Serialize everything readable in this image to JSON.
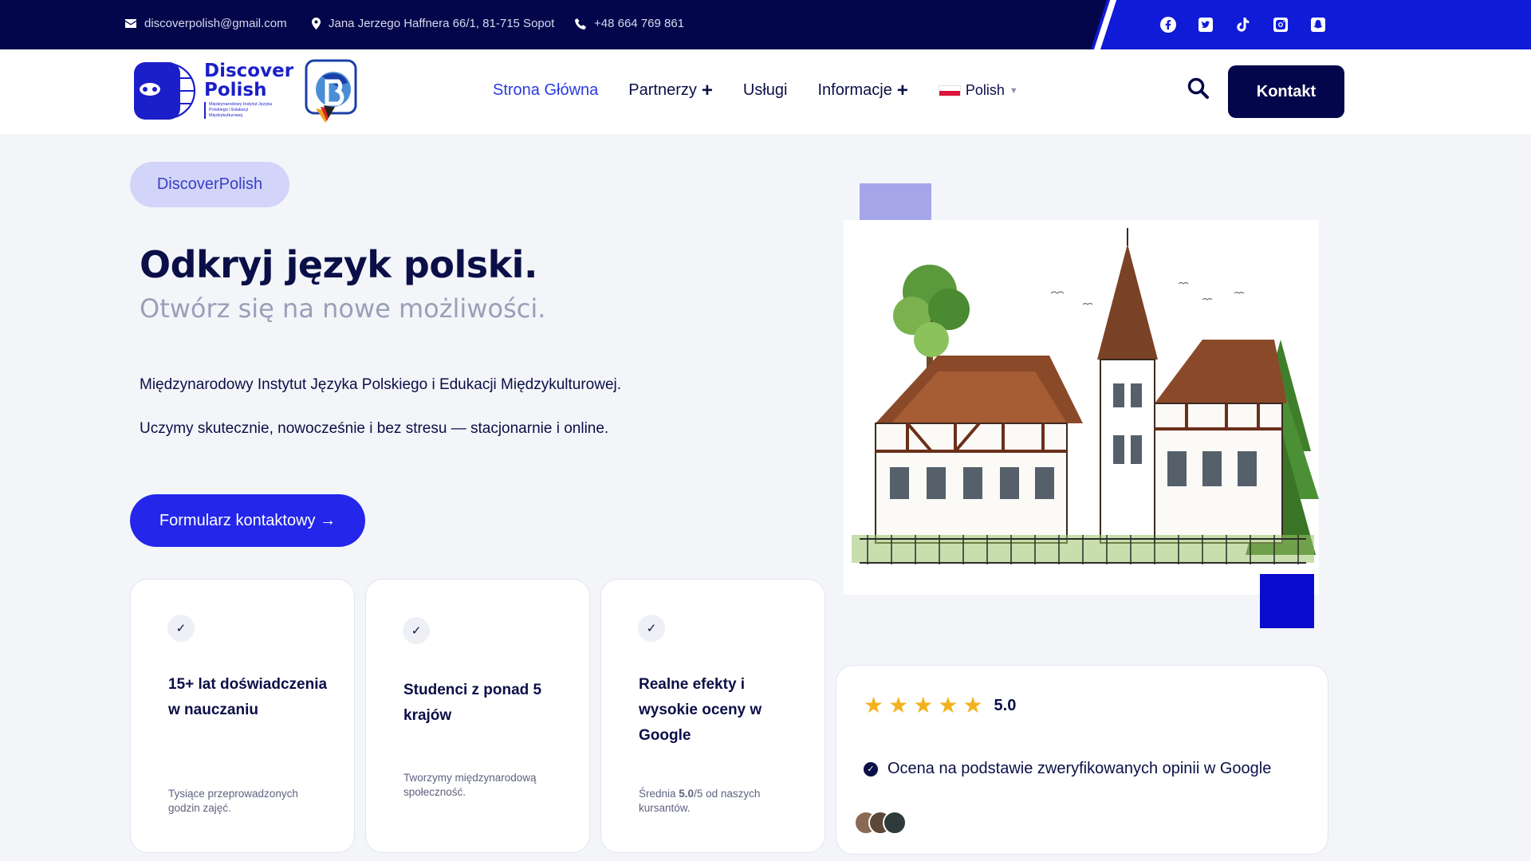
{
  "topbar": {
    "email": "discoverpolish@gmail.com",
    "address": "Jana Jerzego Haffnera 66/1, 81-715 Sopot",
    "phone": "+48 664 769 861",
    "socials": [
      "facebook-icon",
      "twitter-icon",
      "tiktok-icon",
      "instagram-icon",
      "snapchat-icon"
    ]
  },
  "header": {
    "logo_title_1": "Discover",
    "logo_title_2": "Polish",
    "logo_sub": "Międzynarodowy Instytut Języka Polskiego i Edukacji Międzykulturowej",
    "nav": [
      {
        "label": "Strona Główna",
        "active": true
      },
      {
        "label": "Partnerzy",
        "plus": "+"
      },
      {
        "label": "Usługi"
      },
      {
        "label": "Informacje",
        "plus": "+"
      }
    ],
    "language": "Polish",
    "contact_button": "Kontakt"
  },
  "hero": {
    "pill": "DiscoverPolish",
    "title": "Odkryj język polski.",
    "subtitle": "Otwórz się na nowe możliwości.",
    "paragraph_1": "Międzynarodowy Instytut Języka Polskiego i Edukacji Międzykulturowej.",
    "paragraph_2": "Uczymy skutecznie, nowocześnie i bez stresu — stacjonarnie i online.",
    "cta": "Formularz kontaktowy →"
  },
  "features": [
    {
      "title": "15+ lat doświadczenia w nauczaniu",
      "desc": "Tysiące przeprowadzonych godzin zajęć."
    },
    {
      "title": "Studenci z ponad 5 krajów",
      "desc": "Tworzymy międzynarodową społeczność."
    },
    {
      "title": "Realne efekty i wysokie oceny w Google",
      "desc_pre": "Średnia ",
      "desc_bold": "5.0",
      "desc_post": "/5 od naszych kursantów."
    }
  ],
  "rating": {
    "stars": 5,
    "score": "5.0",
    "verified": "Ocena na podstawie zweryfikowanych opinii w Google"
  },
  "colors": {
    "navy": "#03064a",
    "blue": "#2426ea",
    "accent": "#0f1bd6",
    "star": "#f2b21c"
  }
}
